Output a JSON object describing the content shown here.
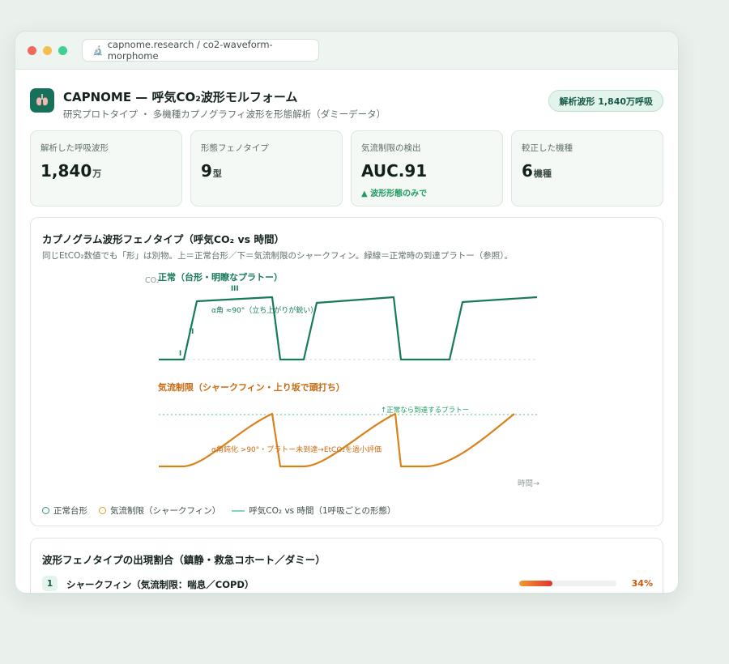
{
  "browser": {
    "url": "capnome.research / co2-waveform-morphome",
    "url_icon": "microscope-icon"
  },
  "header": {
    "icon": "lungs-icon",
    "title": "CAPNOME — 呼気CO₂波形モルフォーム",
    "subtitle": "研究プロトタイプ ・ 多機種カプノグラフィ波形を形態解析（ダミーデータ）",
    "badge": "解析波形 1,840万呼吸"
  },
  "kpis": [
    {
      "label": "解析した呼吸波形",
      "value": "1,840",
      "unit": "万",
      "note": ""
    },
    {
      "label": "形態フェノタイプ",
      "value": "9",
      "unit": "型",
      "note": ""
    },
    {
      "label": "気流制限の検出",
      "value": "AUC.91",
      "unit": "",
      "note": "▲ 波形形態のみで"
    },
    {
      "label": "較正した機種",
      "value": "6",
      "unit": "機種",
      "note": ""
    }
  ],
  "chart_card": {
    "title": "カプノグラム波形フェノタイプ（呼気CO₂ vs 時間）",
    "subtitle": "同じEtCO₂数値でも「形」は別物。上＝正常台形／下＝気流制限のシャークフィン。緑線＝正常時の到達プラトー（参照）。"
  },
  "chart_data": {
    "type": "line",
    "ylabel": "CO₂",
    "xlabel": "時間→",
    "panels": [
      {
        "name": "正常（台形・明瞭なプラトー）",
        "color": "#177a5a",
        "annotations": [
          "α角 ≈90°（立ち上がりが鋭い）"
        ],
        "phase_labels": [
          "I",
          "II",
          "III"
        ]
      },
      {
        "name": "気流制限（シャークフィン・上り坂で頭打ち）",
        "color": "#d9821c",
        "annotations": [
          "α角鈍化 >90°・プラトー未到達→EtCO₂を過小評価",
          "↑正常なら到達するプラトー"
        ]
      }
    ]
  },
  "legend": {
    "items": [
      {
        "label": "正常台形",
        "color": "#177a5a",
        "kind": "circle"
      },
      {
        "label": "気流制限（シャークフィン）",
        "color": "#d9a21c",
        "kind": "circle"
      },
      {
        "label": "呼気CO₂ vs 時間（1呼吸ごとの形態）",
        "color": "#7fd6c0",
        "kind": "line"
      }
    ]
  },
  "list_card": {
    "title": "波形フェノタイプの出現割合（鎮静・救急コホート／ダミー）",
    "rows": [
      {
        "rank": "1",
        "label": "シャークフィン（気流制限：喘息／COPD）",
        "pct_text": "34%",
        "pct": 34
      }
    ]
  }
}
